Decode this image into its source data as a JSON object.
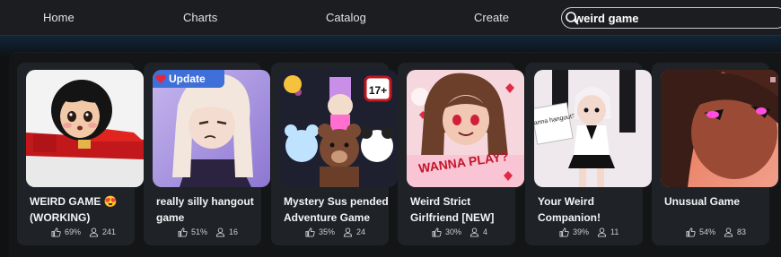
{
  "nav": {
    "home": "Home",
    "charts": "Charts",
    "catalog": "Catalog",
    "create": "Create"
  },
  "search": {
    "value": "weird game",
    "icon": "search-icon"
  },
  "colors": {
    "background": "#0f1113",
    "card": "#1f2226",
    "badge": "#3f6fd8",
    "text": "#f2f4f5"
  },
  "games": [
    {
      "title": "WEIRD GAME 😍\n(WORKING)",
      "rating": "69%",
      "players": "241"
    },
    {
      "title": "really silly hangout\ngame",
      "rating": "51%",
      "players": "16",
      "badge": "Update"
    },
    {
      "title": "Mystery Sus pended\nAdventure Game",
      "rating": "35%",
      "players": "24"
    },
    {
      "title": "Weird Strict\nGirlfriend [NEW]",
      "rating": "30%",
      "players": "4"
    },
    {
      "title": "Your Weird\nCompanion!",
      "rating": "39%",
      "players": "11"
    },
    {
      "title": "Unusual Game",
      "rating": "54%",
      "players": "83"
    }
  ],
  "thumb_text": {
    "age_badge": "17+",
    "sign_wanna_play": "WANNA PLAY?",
    "sign_hangout": "Wanna hangout?"
  }
}
